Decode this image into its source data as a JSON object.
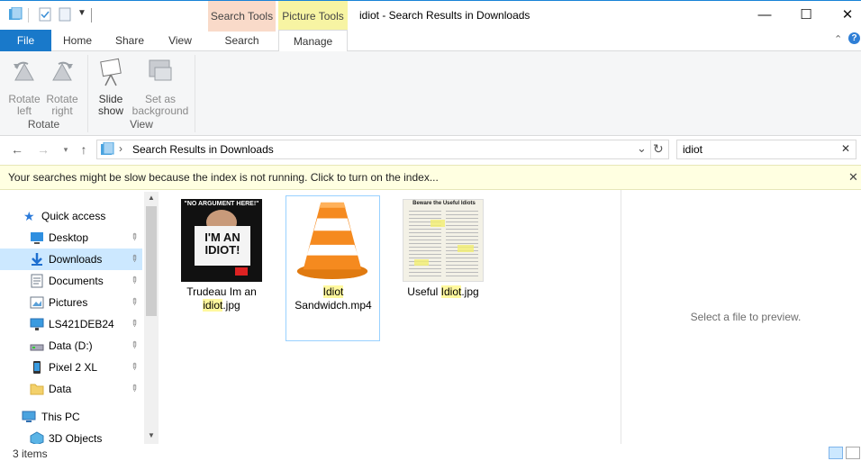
{
  "window": {
    "title": "idiot - Search Results in Downloads",
    "min_glyph": "—",
    "max_glyph": "☐",
    "close_glyph": "✕"
  },
  "context_tabs": {
    "search_tools": "Search Tools",
    "picture_tools": "Picture Tools"
  },
  "tabs": {
    "file": "File",
    "home": "Home",
    "share": "Share",
    "view": "View",
    "search": "Search",
    "manage": "Manage"
  },
  "ribbon": {
    "rotate_left": [
      "Rotate",
      "left"
    ],
    "rotate_right": [
      "Rotate",
      "right"
    ],
    "slide_show": [
      "Slide",
      "show"
    ],
    "set_as_background": [
      "Set as",
      "background"
    ],
    "group_rotate": "Rotate",
    "group_view": "View"
  },
  "address": {
    "path": "Search Results in Downloads",
    "separator": "›",
    "search_value": "idiot"
  },
  "infobar": {
    "message": "Your searches might be slow because the index is not running.  Click to turn on the index..."
  },
  "nav": {
    "quick_access": "Quick access",
    "items": [
      {
        "label": "Desktop",
        "icon": "desktop-icon"
      },
      {
        "label": "Downloads",
        "icon": "downloads-icon"
      },
      {
        "label": "Documents",
        "icon": "documents-icon"
      },
      {
        "label": "Pictures",
        "icon": "pictures-icon"
      },
      {
        "label": "LS421DEB24",
        "icon": "network-drive-icon"
      },
      {
        "label": "Data (D:)",
        "icon": "drive-icon"
      },
      {
        "label": "Pixel 2 XL",
        "icon": "phone-icon"
      },
      {
        "label": "Data",
        "icon": "folder-icon"
      }
    ],
    "this_pc": "This PC",
    "objects_3d": "3D Objects",
    "selected": "Downloads"
  },
  "files": [
    {
      "pre": "Trudeau Im an",
      "hl": "idiot",
      "post": ".jpg",
      "thumb_top": "\"NO ARGUMENT HERE!\"",
      "thumb_sign": "I'M AN IDIOT!"
    },
    {
      "hl": "Idiot",
      "line2": "Sandwidch.mp4"
    },
    {
      "pre": "Useful ",
      "hl": "Idiot",
      "post": ".jpg",
      "thumb_title": "Beware the Useful Idiots"
    }
  ],
  "preview": {
    "message": "Select a file to preview."
  },
  "status": {
    "count": "3 items"
  },
  "colors": {
    "accent": "#1979ca",
    "highlight": "#fff89e",
    "selected_bg": "#cce8ff"
  }
}
